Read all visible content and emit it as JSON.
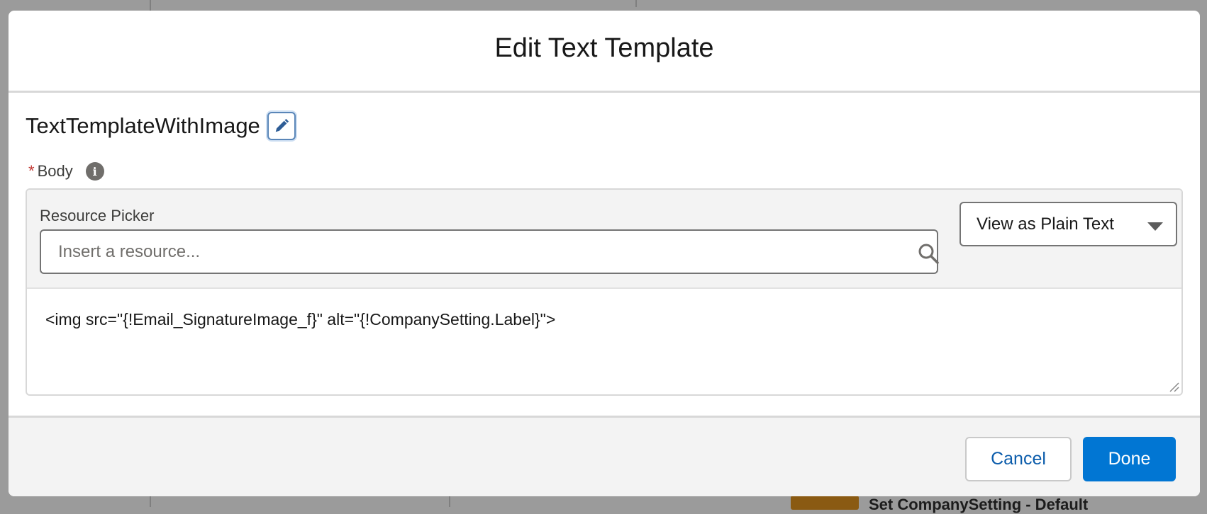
{
  "background": {
    "peek_text": "Set CompanySetting - Default"
  },
  "modal": {
    "title": "Edit Text Template",
    "template_name": "TextTemplateWithImage",
    "edit_icon": "pencil-icon",
    "body": {
      "required_marker": "*",
      "label": "Body",
      "info_icon": "info-icon"
    },
    "resource_picker": {
      "label": "Resource Picker",
      "placeholder": "Insert a resource...",
      "value": "",
      "search_icon": "search-icon"
    },
    "view_mode": {
      "selected": "View as Plain Text",
      "icon": "caret-down-icon"
    },
    "content": "<img src=\"{!Email_SignatureImage_f}\" alt=\"{!CompanySetting.Label}\">",
    "footer": {
      "cancel_label": "Cancel",
      "done_label": "Done"
    }
  },
  "colors": {
    "brand_blue": "#0176d3",
    "link_blue": "#0b5cab",
    "required_red": "#c23934",
    "overlay_gray": "#9b9b9b"
  }
}
